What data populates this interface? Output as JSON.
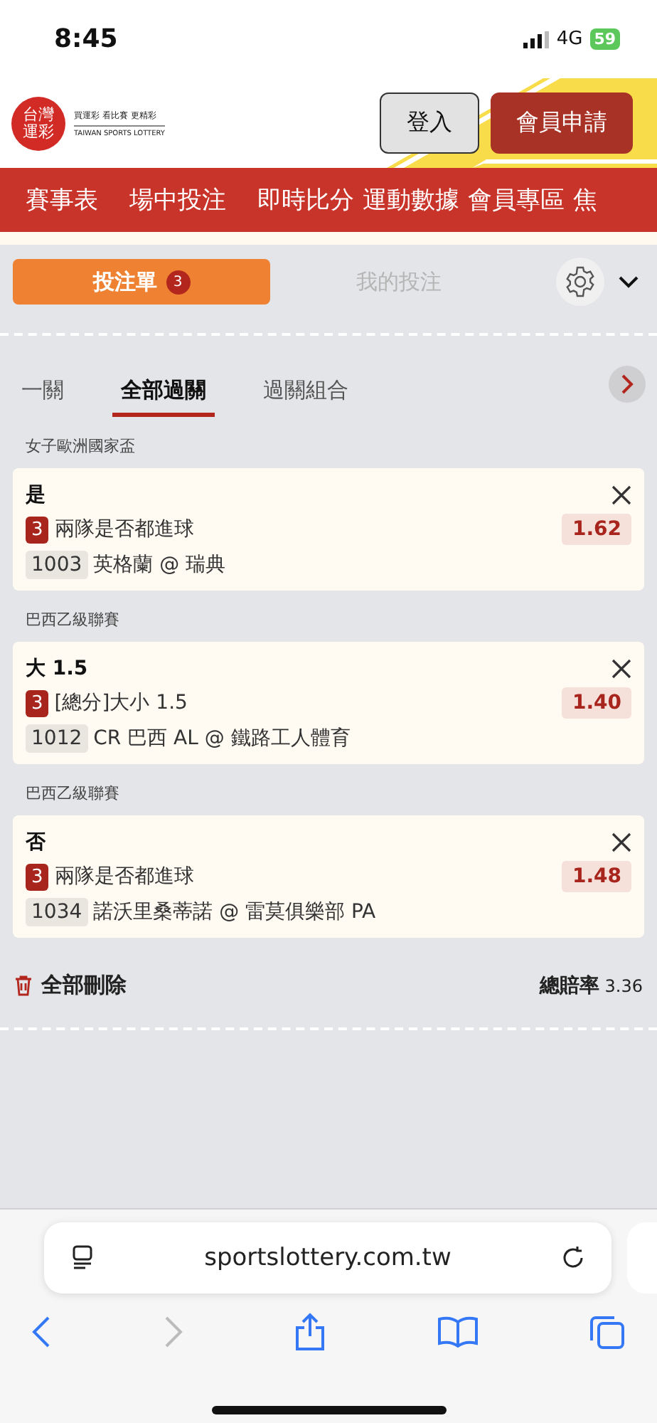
{
  "status_bar": {
    "time": "8:45",
    "network": "4G",
    "battery": "59"
  },
  "header": {
    "logo_mark": "台灣運彩",
    "logo_slogan": "買運彩 看比賽 更精彩",
    "logo_english": "TAIWAN SPORTS LOTTERY",
    "buttons": [
      {
        "label": "登入",
        "kind": "secondary"
      },
      {
        "label": "會員申請",
        "kind": "primary"
      }
    ]
  },
  "nav": [
    "賽事表",
    "場中投注",
    "即時比分",
    "運動數據",
    "會員專區",
    "焦"
  ],
  "bet_tabs": [
    {
      "label": "投注單",
      "badge": "3",
      "selected": true
    },
    {
      "label": "我的投注",
      "selected": false
    }
  ],
  "mode_tabs": [
    {
      "label": "一關",
      "selected": false
    },
    {
      "label": "全部過關",
      "selected": true
    },
    {
      "label": "過關組合",
      "selected": false
    }
  ],
  "bets": [
    {
      "league": "女子歐洲國家盃",
      "selection": "是",
      "badge": "3",
      "market": "兩隊是否都進球",
      "odds": "1.62",
      "code": "1003",
      "match": "英格蘭 @ 瑞典"
    },
    {
      "league": "巴西乙級聯賽",
      "selection": "大 1.5",
      "badge": "3",
      "market": "[總分]大小 1.5",
      "odds": "1.40",
      "code": "1012",
      "match": "CR 巴西 AL @ 鐵路工人體育"
    },
    {
      "league": "巴西乙級聯賽",
      "selection": "否",
      "badge": "3",
      "market": "兩隊是否都進球",
      "odds": "1.48",
      "code": "1034",
      "match": "諾沃里桑蒂諾 @ 雷莫俱樂部 PA"
    }
  ],
  "footer": {
    "delete_all": "全部刪除",
    "total_odds_label": "總賠率",
    "total_odds": "3.36"
  },
  "browser": {
    "url": "sportslottery.com.tw"
  }
}
